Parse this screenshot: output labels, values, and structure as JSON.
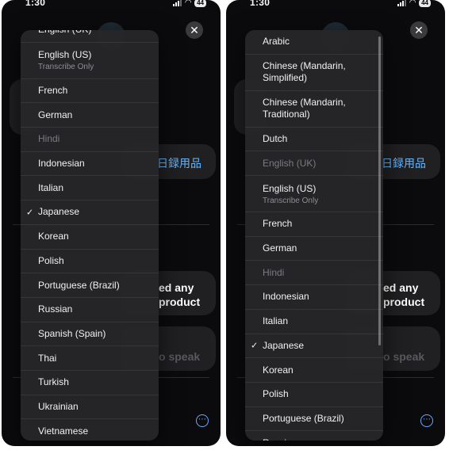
{
  "status_bar": {
    "time": "1:30",
    "battery": "44"
  },
  "screens": [
    {
      "id": "left",
      "languages": [
        {
          "label": "English (UK)",
          "sub": "",
          "state": "normal",
          "size": "h1"
        },
        {
          "label": "English (US)",
          "sub": "Transcribe Only",
          "state": "normal",
          "size": "h2"
        },
        {
          "label": "French",
          "sub": "",
          "state": "normal",
          "size": "h1"
        },
        {
          "label": "German",
          "sub": "",
          "state": "normal",
          "size": "h1"
        },
        {
          "label": "Hindi",
          "sub": "",
          "state": "disabled",
          "size": "h1"
        },
        {
          "label": "Indonesian",
          "sub": "",
          "state": "normal",
          "size": "h1"
        },
        {
          "label": "Italian",
          "sub": "",
          "state": "normal",
          "size": "h1"
        },
        {
          "label": "Japanese",
          "sub": "",
          "state": "selected",
          "size": "h1"
        },
        {
          "label": "Korean",
          "sub": "",
          "state": "normal",
          "size": "h1"
        },
        {
          "label": "Polish",
          "sub": "",
          "state": "normal",
          "size": "h1"
        },
        {
          "label": "Portuguese (Brazil)",
          "sub": "",
          "state": "normal",
          "size": "h1"
        },
        {
          "label": "Russian",
          "sub": "",
          "state": "normal",
          "size": "h1"
        },
        {
          "label": "Spanish (Spain)",
          "sub": "",
          "state": "normal",
          "size": "h1"
        },
        {
          "label": "Thai",
          "sub": "",
          "state": "normal",
          "size": "h1"
        },
        {
          "label": "Turkish",
          "sub": "",
          "state": "normal",
          "size": "h1"
        },
        {
          "label": "Ukrainian",
          "sub": "",
          "state": "normal",
          "size": "h1"
        },
        {
          "label": "Vietnamese",
          "sub": "",
          "state": "normal",
          "size": "h1"
        }
      ]
    },
    {
      "id": "right",
      "languages": [
        {
          "label": "Arabic",
          "sub": "",
          "state": "normal",
          "size": "h1"
        },
        {
          "label": "Chinese (Mandarin, Simplified)",
          "sub": "",
          "state": "normal",
          "size": "h2"
        },
        {
          "label": "Chinese (Mandarin, Traditional)",
          "sub": "",
          "state": "normal",
          "size": "h2"
        },
        {
          "label": "Dutch",
          "sub": "",
          "state": "normal",
          "size": "h1"
        },
        {
          "label": "English (UK)",
          "sub": "",
          "state": "disabled",
          "size": "h1"
        },
        {
          "label": "English (US)",
          "sub": "Transcribe Only",
          "state": "normal",
          "size": "h2"
        },
        {
          "label": "French",
          "sub": "",
          "state": "normal",
          "size": "h1"
        },
        {
          "label": "German",
          "sub": "",
          "state": "normal",
          "size": "h1"
        },
        {
          "label": "Hindi",
          "sub": "",
          "state": "disabled",
          "size": "h1"
        },
        {
          "label": "Indonesian",
          "sub": "",
          "state": "normal",
          "size": "h1"
        },
        {
          "label": "Italian",
          "sub": "",
          "state": "normal",
          "size": "h1"
        },
        {
          "label": "Japanese",
          "sub": "",
          "state": "selected",
          "size": "h1"
        },
        {
          "label": "Korean",
          "sub": "",
          "state": "normal",
          "size": "h1"
        },
        {
          "label": "Polish",
          "sub": "",
          "state": "normal",
          "size": "h1"
        },
        {
          "label": "Portuguese (Brazil)",
          "sub": "",
          "state": "normal",
          "size": "h1"
        },
        {
          "label": "Russian",
          "sub": "",
          "state": "normal",
          "size": "h1"
        }
      ]
    }
  ],
  "background": {
    "translated_japanese": "日録用品",
    "line_1_fragment": "ed any",
    "line_2_fragment": "product",
    "hint_fragment": "o speak"
  },
  "icons": {
    "close": "close-icon",
    "more": "more-icon",
    "check": "checkmark-icon"
  },
  "colors": {
    "menu_bg": "#262629",
    "accent_blue": "#63b6ff",
    "disabled_text": "#7b7b80"
  }
}
